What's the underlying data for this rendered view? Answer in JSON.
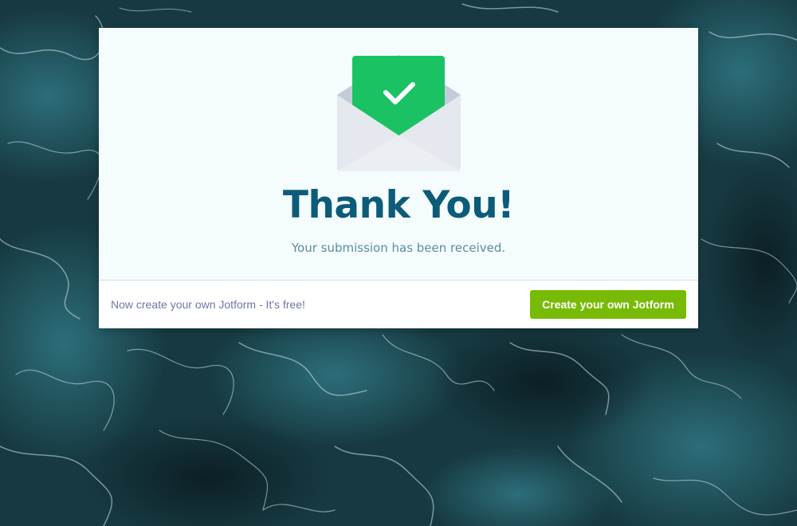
{
  "page": {
    "background": "ocean-water-photo"
  },
  "card": {
    "icon": "envelope-check-icon",
    "title": "Thank You!",
    "subtitle": "Your submission has been received."
  },
  "footer": {
    "promo_text": "Now create your own Jotform - It's free!",
    "cta_label": "Create your own Jotform"
  },
  "colors": {
    "title": "#0c5b79",
    "subtitle": "#5a8ca2",
    "card_background": "#f5fcfd",
    "check_green": "#1bc263",
    "cta_green": "#78bb07",
    "promo_text": "#6f76a7"
  }
}
